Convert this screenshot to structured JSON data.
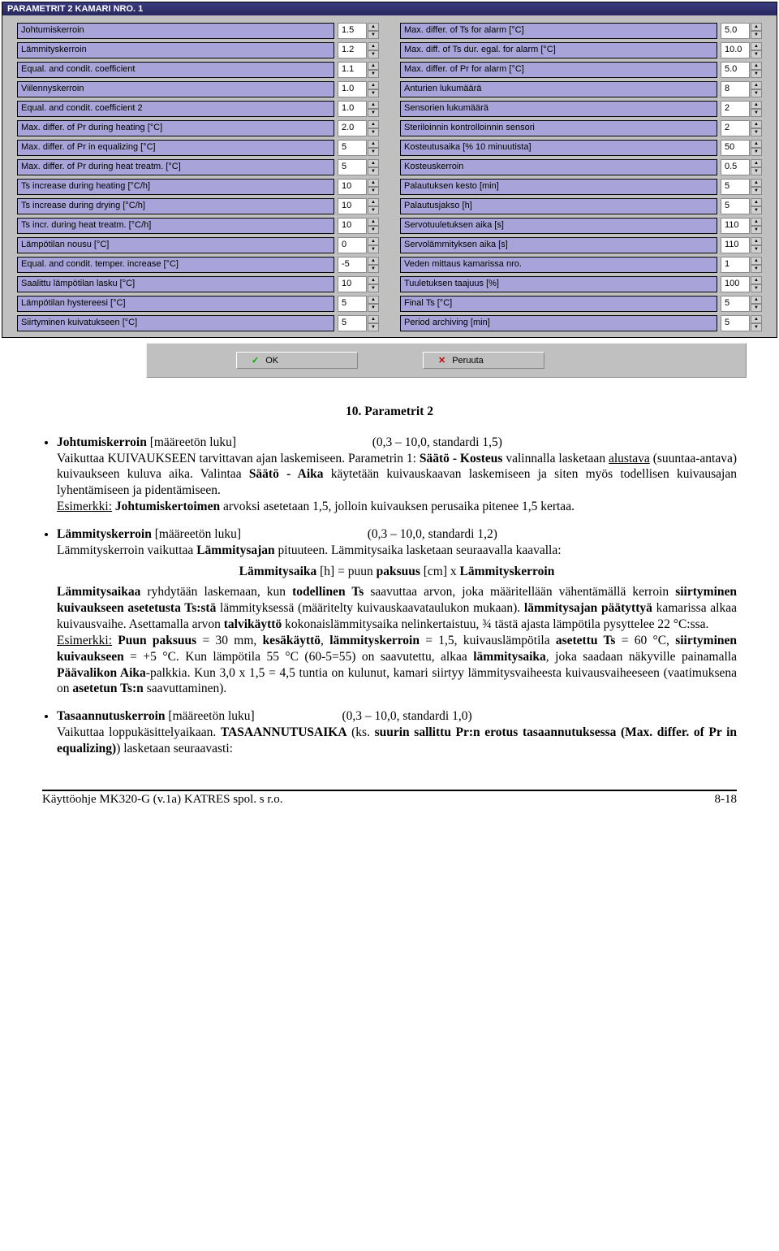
{
  "titlebar": "PARAMETRIT 2    KAMARI NRO. 1",
  "left_params": [
    {
      "label": "Johtumiskerroin",
      "value": "1.5"
    },
    {
      "label": "Lämmityskerroin",
      "value": "1.2"
    },
    {
      "label": "Equal. and condit. coefficient",
      "value": "1.1"
    },
    {
      "label": "Viilennyskerroin",
      "value": "1.0"
    },
    {
      "label": "Equal. and condit. coefficient 2",
      "value": "1.0"
    },
    {
      "label": "Max. differ. of Pr during heating  [°C]",
      "value": "2.0"
    },
    {
      "label": "Max. differ. of Pr in equalizing [°C]",
      "value": "5"
    },
    {
      "label": "Max. differ. of Pr during heat treatm.  [°C]",
      "value": "5"
    },
    {
      "label": "Ts increase during heating  [°C/h]",
      "value": "10"
    },
    {
      "label": "Ts increase during drying [°C/h]",
      "value": "10"
    },
    {
      "label": "Ts incr. during heat treatm.  [°C/h]",
      "value": "10"
    },
    {
      "label": "Lämpötilan nousu [°C]",
      "value": "0"
    },
    {
      "label": "Equal. and condit. temper. increase  [°C]",
      "value": "-5"
    },
    {
      "label": "Saalittu lämpötilan lasku [°C]",
      "value": "10"
    },
    {
      "label": "Lämpötilan hystereesi [°C]",
      "value": "5"
    },
    {
      "label": "Siirtyminen kuivatukseen [°C]",
      "value": "5"
    }
  ],
  "right_params": [
    {
      "label": "Max. differ. of Ts for alarm  [°C]",
      "value": "5.0"
    },
    {
      "label": "Max. diff. of Ts dur. egal. for alarm [°C]",
      "value": "10.0"
    },
    {
      "label": "Max. differ. of Pr for alarm  [°C]",
      "value": "5.0"
    },
    {
      "label": "Anturien lukumäärä",
      "value": "8"
    },
    {
      "label": "Sensorien lukumäärä",
      "value": "2"
    },
    {
      "label": "Steriloinnin kontrolloinnin sensori",
      "value": "2"
    },
    {
      "label": "Kosteutusaika  [% 10 minuutista]",
      "value": "50"
    },
    {
      "label": "Kosteuskerroin",
      "value": "0.5"
    },
    {
      "label": "Palautuksen kesto [min]",
      "value": "5"
    },
    {
      "label": "Palautusjakso [h]",
      "value": "5"
    },
    {
      "label": "Servotuuletuksen aika [s]",
      "value": "110"
    },
    {
      "label": "Servolämmityksen aika [s]",
      "value": "110"
    },
    {
      "label": "Veden mittaus kamarissa nro.",
      "value": "1"
    },
    {
      "label": "Tuuletuksen taajuus [%]",
      "value": "100"
    },
    {
      "label": "Final Ts  [°C]",
      "value": "5"
    },
    {
      "label": "Period archiving  [min]",
      "value": "5"
    }
  ],
  "buttons": {
    "ok": "OK",
    "cancel": "Peruuta"
  },
  "caption": "10.      Parametrit 2",
  "b1": {
    "title": "Johtumiskerroin",
    "unit": " [määreetön luku]",
    "range": "(0,3 – 10,0, standardi 1,5)",
    "p1a": "Vaikuttaa KUIVAUKSEEN tarvittavan ajan laskemiseen. Parametrin 1: ",
    "p1b": "Säätö - Kosteus",
    "p1c": " valinnalla lasketaan ",
    "p1d": "alustava",
    "p1e": " (suuntaa-antava) kuivaukseen kuluva aika. Valintaa ",
    "p1f": "Säätö - Aika",
    "p1g": " käytetään kuivauskaavan laskemiseen ja siten myös todellisen kuivausajan lyhentämiseen ja pidentämiseen.",
    "ex_u": "Esimerkki:",
    "ex_b": " Johtumiskertoimen",
    "ex_t": " arvoksi asetetaan 1,5, jolloin kuivauksen perusaika pitenee 1,5 kertaa."
  },
  "b2": {
    "title": "Lämmityskerroin",
    "unit": " [määreetön luku]",
    "range": "(0,3 – 10,0, standardi 1,2)",
    "p1a": "Lämmityskerroin vaikuttaa ",
    "p1b": "Lämmitysajan",
    "p1c": " pituuteen. Lämmitysaika lasketaan seuraavalla kaavalla:",
    "formula_a": "Lämmitysaika",
    "formula_b": " [h]  =  puun ",
    "formula_c": "paksuus",
    "formula_d": " [cm]   x   ",
    "formula_e": "Lämmityskerroin",
    "p2a": "Lämmitysaikaa",
    "p2b": " ryhdytään laskemaan, kun ",
    "p2c": "todellinen Ts",
    "p2d": " saavuttaa arvon, joka määritellään vähentämällä kerroin ",
    "p2e": "siirtyminen kuivaukseen asetetusta Ts:stä",
    "p2f": " lämmityksessä (määritelty kuivauskaavataulukon mukaan). ",
    "p2g": "lämmitysajan päätyttyä",
    "p2h": " kamarissa alkaa kuivausvaihe. Asettamalla arvon ",
    "p2i": "talvikäyttö",
    "p2j": " kokonaislämmitysaika nelinkertaistuu, ¾ tästä ajasta lämpötila pysyttelee 22 °C:ssa.",
    "ex_u": "Esimerkki:",
    "ex1": "  Puun paksuus",
    "ex2": " = 30 mm,  ",
    "ex3": "kesäkäyttö",
    "ex4": ",  ",
    "ex5": "lämmityskerroin",
    "ex6": " = 1,5,  kuivauslämpötila ",
    "ex7": "asetettu Ts",
    "ex8": " = 60 °C, ",
    "ex9": "siirtyminen kuivaukseen",
    "ex10": " = +5 °C. Kun lämpötila 55 °C (60-5=55) on saavutettu, alkaa ",
    "ex11": "lämmitysaika",
    "ex12": ", joka saadaan näkyville painamalla ",
    "ex13": "Päävalikon Aika",
    "ex14": "-palkkia. Kun 3,0 x 1,5 = 4,5 tuntia on kulunut, kamari siirtyy lämmitysvaiheesta kuivausvaiheeseen (vaatimuksena on ",
    "ex15": "asetetun Ts:n",
    "ex16": " saavuttaminen)."
  },
  "b3": {
    "title": "Tasaannutuskerroin",
    "unit": " [määreetön luku]",
    "range": "(0,3 – 10,0, standardi 1,0)",
    "p1a": "Vaikuttaa loppukäsittelyaikaan. ",
    "p1b": "TASAANNUTUSAIKA",
    "p1c": " (ks. ",
    "p1d": "suurin sallittu Pr:n erotus tasaannutuksessa (Max. differ. of Pr in equalizing)",
    "p1e": ") lasketaan seuraavasti:"
  },
  "footer": {
    "left": "Käyttöohje  MK320-G (v.1a)  KATRES spol. s r.o.",
    "right": "8-18"
  }
}
